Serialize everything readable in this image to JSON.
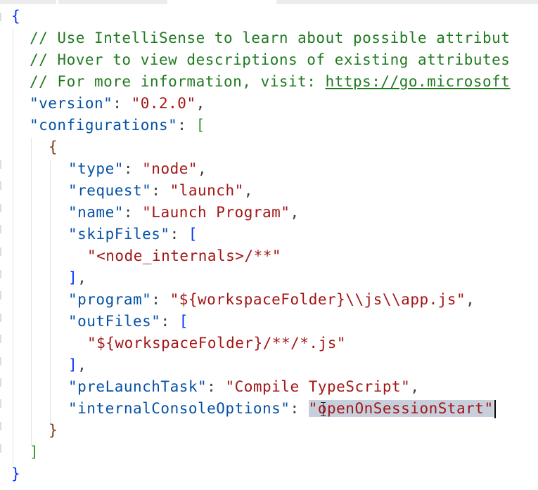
{
  "editor": {
    "lines": {
      "l1": {
        "brace": "{"
      },
      "l2": {
        "comment": "// Use IntelliSense to learn about possible attribut"
      },
      "l3": {
        "comment": "// Hover to view descriptions of existing attributes"
      },
      "l4": {
        "comment": "// For more information, visit: ",
        "link": "https://go.microsoft"
      },
      "l5": {
        "key": "\"version\"",
        "sep": ": ",
        "value": "\"0.2.0\"",
        "end": ","
      },
      "l6": {
        "key": "\"configurations\"",
        "sep": ": ",
        "bracket": "["
      },
      "l7": {
        "brace": "{"
      },
      "l8": {
        "key": "\"type\"",
        "sep": ": ",
        "value": "\"node\"",
        "end": ","
      },
      "l9": {
        "key": "\"request\"",
        "sep": ": ",
        "value": "\"launch\"",
        "end": ","
      },
      "l10": {
        "key": "\"name\"",
        "sep": ": ",
        "value": "\"Launch Program\"",
        "end": ","
      },
      "l11": {
        "key": "\"skipFiles\"",
        "sep": ": ",
        "bracket": "["
      },
      "l12": {
        "value": "\"<node_internals>/**\""
      },
      "l13": {
        "bracket": "]",
        "end": ","
      },
      "l14": {
        "key": "\"program\"",
        "sep": ": ",
        "value": "\"${workspaceFolder}\\\\js\\\\app.js\"",
        "end": ","
      },
      "l15": {
        "key": "\"outFiles\"",
        "sep": ": ",
        "bracket": "["
      },
      "l16": {
        "value": "\"${workspaceFolder}/**/*.js\""
      },
      "l17": {
        "bracket": "]",
        "end": ","
      },
      "l18": {
        "key": "\"preLaunchTask\"",
        "sep": ": ",
        "value": "\"Compile TypeScript\"",
        "end": ","
      },
      "l19": {
        "key": "\"internalConsoleOptions\"",
        "sep": ": ",
        "value": "\"openOnSessionStart\""
      },
      "l20": {
        "brace": "}"
      },
      "l21": {
        "bracket": "]"
      },
      "l22": {
        "brace": "}"
      }
    }
  },
  "colors": {
    "comment": "#1f7a1f",
    "key": "#0451a5",
    "string": "#a31515",
    "brace": "#0431fa",
    "bracket": "#319331",
    "selection": "#c8cfdc"
  }
}
